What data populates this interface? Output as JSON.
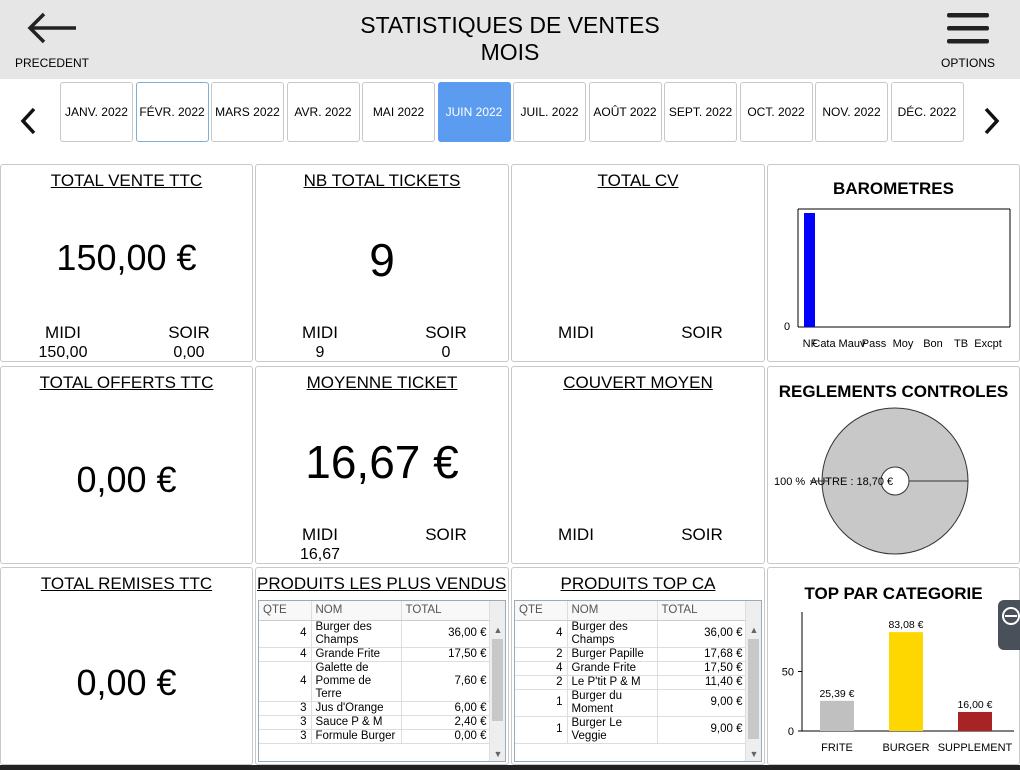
{
  "header": {
    "title_line1": "STATISTIQUES DE VENTES",
    "title_line2": "MOIS",
    "prev_label": "PRECEDENT",
    "options_label": "OPTIONS"
  },
  "icons": {
    "back": "arrow-left-icon",
    "menu": "hamburger-menu-icon",
    "nav_left": "chevron-left-icon",
    "nav_right": "chevron-right-icon"
  },
  "colors": {
    "active_month": "#5b9cf0",
    "barometre_bar": "#0000ff",
    "frite": "#c0c0c0",
    "burger": "#ffd700",
    "supplement": "#a82424",
    "pie": "#c8c8c8"
  },
  "months": [
    "JANV. 2022",
    "FÉVR. 2022",
    "MARS 2022",
    "AVR. 2022",
    "MAI 2022",
    "JUIN 2022",
    "JUIL. 2022",
    "AOÛT 2022",
    "SEPT. 2022",
    "OCT. 2022",
    "NOV. 2022",
    "DÉC. 2022"
  ],
  "active_month": "JUIN 2022",
  "cards": {
    "total_vente": {
      "title": "TOTAL VENTE TTC",
      "value": "150,00 €",
      "midi_label": "MIDI",
      "soir_label": "SOIR",
      "midi_value": "150,00",
      "soir_value": "0,00"
    },
    "nb_tickets": {
      "title": "NB TOTAL TICKETS",
      "value": "9",
      "midi_label": "MIDI",
      "soir_label": "SOIR",
      "midi_value": "9",
      "soir_value": "0"
    },
    "total_cv": {
      "title": "TOTAL CV",
      "midi_label": "MIDI",
      "soir_label": "SOIR"
    },
    "total_offerts": {
      "title": "TOTAL OFFERTS TTC",
      "value": "0,00 €"
    },
    "moyenne_ticket": {
      "title": "MOYENNE TICKET",
      "value": "16,67 €",
      "midi_label": "MIDI",
      "soir_label": "SOIR",
      "midi_value": "16,67"
    },
    "couvert_moyen": {
      "title": "COUVERT MOYEN",
      "midi_label": "MIDI",
      "soir_label": "SOIR"
    },
    "total_remises": {
      "title": "TOTAL REMISES TTC",
      "value": "0,00 €"
    }
  },
  "produits_vendus": {
    "title": "PRODUITS LES PLUS VENDUS",
    "columns": [
      "QTE",
      "NOM",
      "TOTAL"
    ],
    "rows": [
      {
        "qte": "4",
        "nom": "Burger des Champs",
        "total": "36,00 €"
      },
      {
        "qte": "4",
        "nom": "Grande Frite",
        "total": "17,50 €"
      },
      {
        "qte": "4",
        "nom": "Galette de Pomme de Terre",
        "total": "7,60 €"
      },
      {
        "qte": "3",
        "nom": "Jus d'Orange",
        "total": "6,00 €"
      },
      {
        "qte": "3",
        "nom": "Sauce P & M",
        "total": "2,40 €"
      },
      {
        "qte": "3",
        "nom": "Formule Burger",
        "total": "0,00 €"
      }
    ]
  },
  "produits_ca": {
    "title": "PRODUITS TOP CA",
    "columns": [
      "QTE",
      "NOM",
      "TOTAL"
    ],
    "rows": [
      {
        "qte": "4",
        "nom": "Burger des Champs",
        "total": "36,00 €"
      },
      {
        "qte": "2",
        "nom": "Burger Papille",
        "total": "17,68 €"
      },
      {
        "qte": "4",
        "nom": "Grande Frite",
        "total": "17,50 €"
      },
      {
        "qte": "2",
        "nom": "Le P'tit P & M",
        "total": "11,40 €"
      },
      {
        "qte": "1",
        "nom": "Burger du Moment",
        "total": "9,00 €"
      },
      {
        "qte": "1",
        "nom": "Burger Le Veggie",
        "total": "9,00 €"
      }
    ]
  },
  "barometres": {
    "title": "BAROMETRES",
    "zero_label": "0",
    "categories": [
      "NF",
      "Cata",
      "Mauv",
      "Pass",
      "Moy",
      "Bon",
      "TB",
      "Excpt"
    ],
    "values": [
      1,
      0,
      0,
      0,
      0,
      0,
      0,
      0
    ]
  },
  "reglements": {
    "title": "REGLEMENTS CONTROLES",
    "percent_label": "100 %",
    "slice_label": "AUTRE : 18,70 €",
    "percent": 100
  },
  "top_categorie": {
    "title": "TOP PAR CATEGORIE",
    "categories": [
      "FRITE",
      "BURGER",
      "SUPPLEMENT"
    ],
    "values": [
      25.39,
      83.08,
      16.0
    ],
    "value_labels": [
      "25,39 €",
      "83,08 €",
      "16,00 €"
    ],
    "yticks": [
      "0",
      "50"
    ],
    "ylim": [
      0,
      100
    ]
  }
}
